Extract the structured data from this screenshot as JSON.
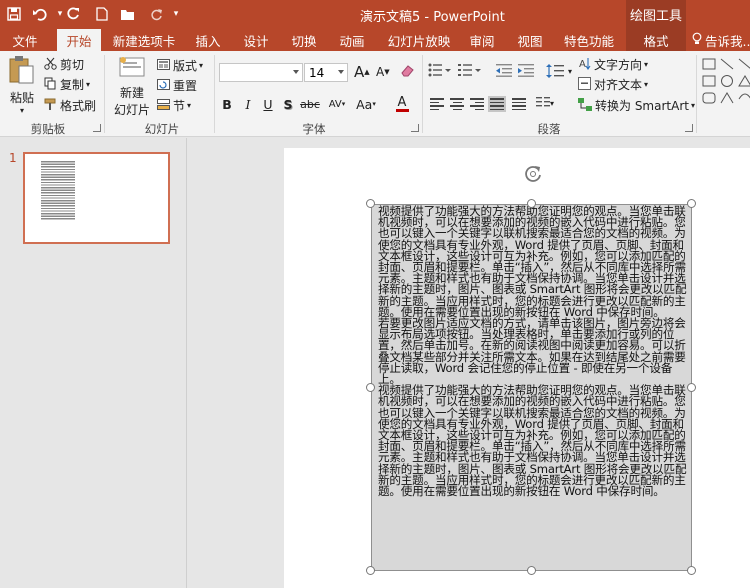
{
  "app": {
    "title": "演示文稿5 - PowerPoint",
    "context_tab_header": "绘图工具",
    "accent": "#b7472a"
  },
  "quick_access": {
    "icons": [
      "save-icon",
      "undo-icon",
      "redo-icon",
      "new-icon",
      "open-icon",
      "refresh-icon",
      "touch-mode-icon"
    ]
  },
  "tabs": [
    {
      "label": "文件"
    },
    {
      "label": "开始"
    },
    {
      "label": "新建选项卡"
    },
    {
      "label": "插入"
    },
    {
      "label": "设计"
    },
    {
      "label": "切换"
    },
    {
      "label": "动画"
    },
    {
      "label": "幻灯片放映"
    },
    {
      "label": "审阅"
    },
    {
      "label": "视图"
    },
    {
      "label": "特色功能"
    },
    {
      "label": "格式"
    }
  ],
  "tell_me": "告诉我...",
  "active_tab": "开始",
  "ribbon": {
    "clipboard": {
      "paste": "粘贴",
      "cut": "剪切",
      "copy": "复制",
      "format_painter": "格式刷",
      "label": "剪贴板"
    },
    "slides": {
      "new_slide_1": "新建",
      "new_slide_2": "幻灯片",
      "layout": "版式",
      "reset": "重置",
      "section": "节",
      "label": "幻灯片"
    },
    "font": {
      "font_name": "",
      "font_size": "14",
      "bold": "B",
      "italic": "I",
      "underline": "U",
      "shadow": "S",
      "strikethrough": "abc",
      "spacing": "AV",
      "change_case": "Aa",
      "font_color": "A",
      "grow": "A",
      "shrink": "A",
      "label": "字体"
    },
    "paragraph": {
      "text_direction": "文字方向",
      "align_text": "对齐文本",
      "smartart": "转换为 SmartArt",
      "label": "段落"
    }
  },
  "slide_panel": {
    "slide_number": "1"
  },
  "textbox": {
    "paragraphs": [
      "视频提供了功能强大的方法帮助您证明您的观点。当您单击联机视频时，可以在想要添加的视频的嵌入代码中进行粘贴。您也可以键入一个关键字以联机搜索最适合您的文档的视频。为使您的文档具有专业外观，Word 提供了页眉、页脚、封面和文本框设计，这些设计可互为补充。例如，您可以添加匹配的封面、页眉和提要栏。单击“插入”，然后从不同库中选择所需元素。主题和样式也有助于文档保持协调。当您单击设计并选择新的主题时，图片、图表或 SmartArt 图形将会更改以匹配新的主题。当应用样式时，您的标题会进行更改以匹配新的主题。使用在需要位置出现的新按钮在 Word 中保存时间。",
      "若要更改图片适应文档的方式，请单击该图片，图片旁边将会显示布局选项按钮。当处理表格时，单击要添加行或列的位置，然后单击加号。在新的阅读视图中阅读更加容易。可以折叠文档某些部分并关注所需文本。如果在达到结尾处之前需要停止读取，Word 会记住您的停止位置 - 即使在另一个设备上。",
      "视频提供了功能强大的方法帮助您证明您的观点。当您单击联机视频时，可以在想要添加的视频的嵌入代码中进行粘贴。您也可以键入一个关键字以联机搜索最适合您的文档的视频。为使您的文档具有专业外观，Word 提供了页眉、页脚、封面和文本框设计，这些设计可互为补充。例如，您可以添加匹配的封面、页眉和提要栏。单击“插入”，然后从不同库中选择所需元素。主题和样式也有助于文档保持协调。当您单击设计并选择新的主题时，图片、图表或 SmartArt 图形将会更改以匹配新的主题。当应用样式时，您的标题会进行更改以匹配新的主题。使用在需要位置出现的新按钮在 Word 中保存时间。"
    ]
  }
}
